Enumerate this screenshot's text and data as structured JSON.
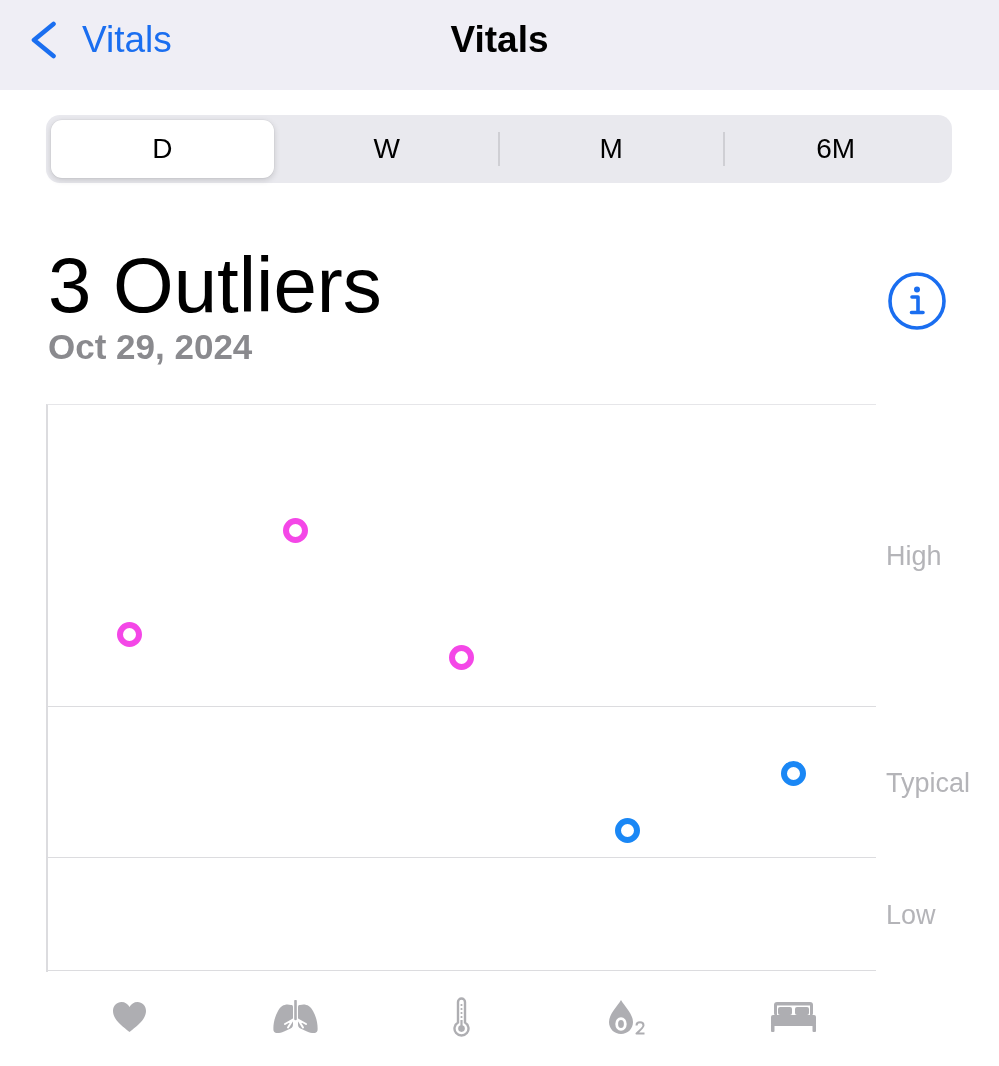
{
  "nav": {
    "back_label": "Vitals",
    "title": "Vitals"
  },
  "segments": [
    {
      "label": "D",
      "selected": true
    },
    {
      "label": "W",
      "selected": false
    },
    {
      "label": "M",
      "selected": false
    },
    {
      "label": "6M",
      "selected": false
    }
  ],
  "summary": {
    "title": "3 Outliers",
    "date": "Oct 29, 2024"
  },
  "chart": {
    "bands": [
      {
        "label": "High"
      },
      {
        "label": "Typical"
      },
      {
        "label": "Low"
      }
    ],
    "points": [
      {
        "color": "#f447e7"
      },
      {
        "color": "#f447e7"
      },
      {
        "color": "#f447e7"
      },
      {
        "color": "#1a87f5"
      },
      {
        "color": "#1a87f5"
      }
    ]
  }
}
